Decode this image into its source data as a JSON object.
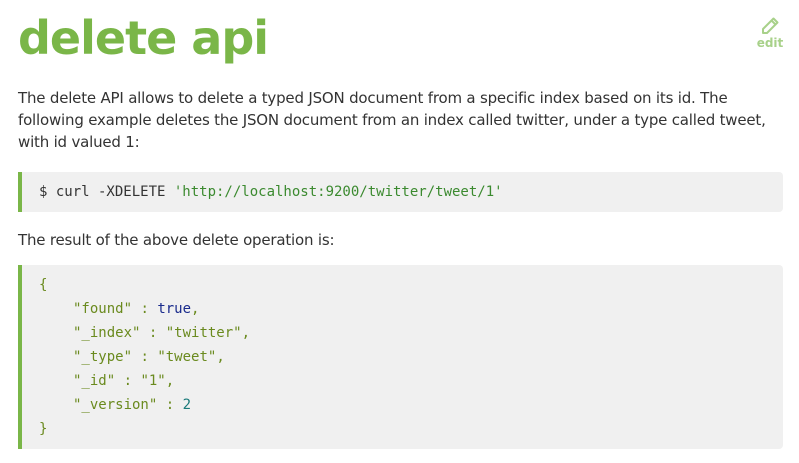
{
  "page": {
    "title": "delete api",
    "edit_label": "edit",
    "edit_icon": "pencil-icon",
    "accent_color": "#7ab648",
    "code_background": "#f0f0f0"
  },
  "intro": "The delete API allows to delete a typed JSON document from a specific index based on its id. The following example deletes the JSON document from an index called twitter, under a type called tweet, with id valued 1:",
  "command": {
    "prompt": "$ curl -XDELETE ",
    "url": "'http://localhost:9200/twitter/tweet/1'"
  },
  "result_intro": "The result of the above delete operation is:",
  "result": {
    "open_brace": "{",
    "close_brace": "}",
    "fields": [
      {
        "key": "\"found\"",
        "sep": " : ",
        "value": "true",
        "type": "kw",
        "comma": ","
      },
      {
        "key": "\"_index\"",
        "sep": " : ",
        "value": "\"twitter\"",
        "type": "str",
        "comma": ","
      },
      {
        "key": "\"_type\"",
        "sep": " : ",
        "value": "\"tweet\"",
        "type": "str",
        "comma": ","
      },
      {
        "key": "\"_id\"",
        "sep": " : ",
        "value": "\"1\"",
        "type": "str",
        "comma": ","
      },
      {
        "key": "\"_version\"",
        "sep": " : ",
        "value": "2",
        "type": "num",
        "comma": ""
      }
    ]
  }
}
